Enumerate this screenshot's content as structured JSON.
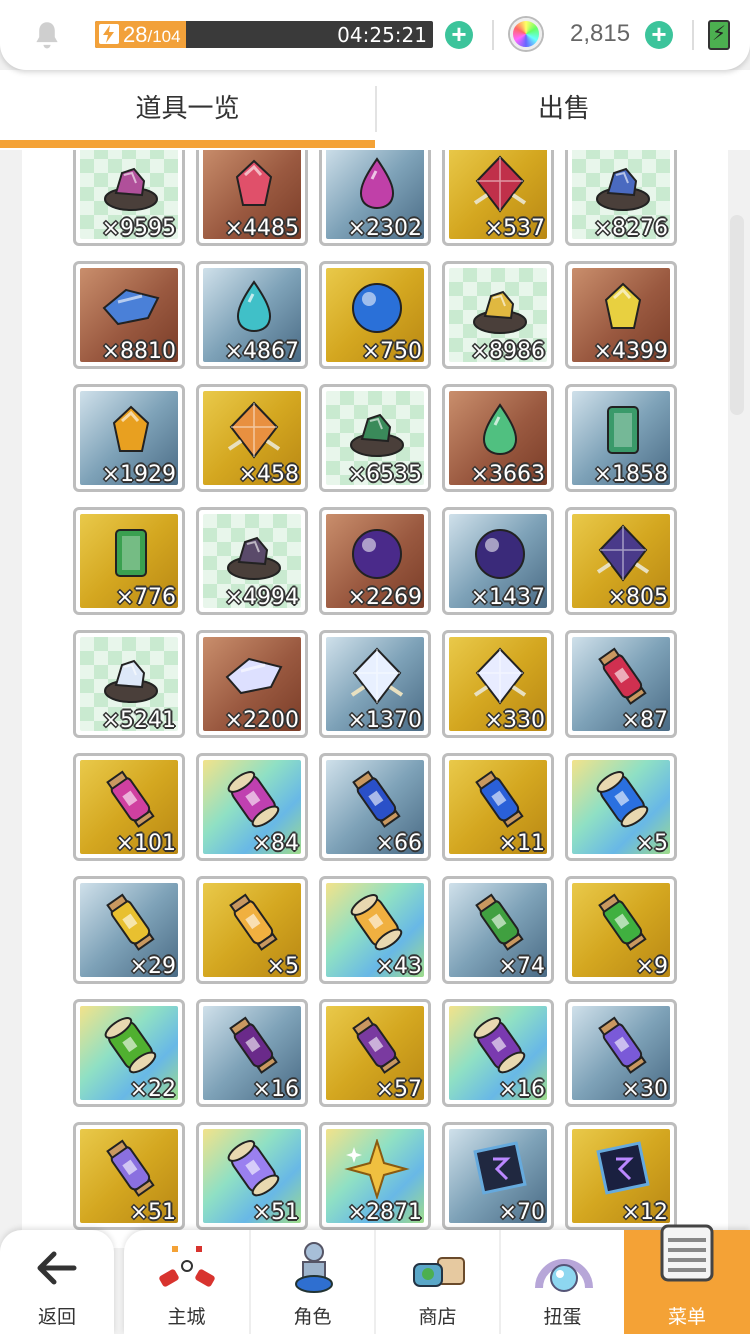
{
  "status": {
    "stamina_current": "28",
    "stamina_max": "/104",
    "stamina_fill": 0.27,
    "timer": "04:25:21",
    "currency": "2,815",
    "battery_symbol": "⚡"
  },
  "tabs": [
    {
      "label": "道具一览",
      "active": true
    },
    {
      "label": "出售",
      "active": false
    }
  ],
  "items": [
    {
      "count": "×9595",
      "bg": "green",
      "shape": "ore",
      "color": "#b0509a"
    },
    {
      "count": "×4485",
      "bg": "brown",
      "shape": "gem",
      "color": "#e0506a"
    },
    {
      "count": "×2302",
      "bg": "blue",
      "shape": "drop",
      "color": "#c040a8"
    },
    {
      "count": "×537",
      "bg": "gold",
      "shape": "crystal",
      "color": "#c0304a"
    },
    {
      "count": "×8276",
      "bg": "green",
      "shape": "ore",
      "color": "#4a6ac0"
    },
    {
      "count": "×8810",
      "bg": "brown",
      "shape": "shard",
      "color": "#4a80d8"
    },
    {
      "count": "×4867",
      "bg": "blue",
      "shape": "drop",
      "color": "#40c0c8"
    },
    {
      "count": "×750",
      "bg": "gold",
      "shape": "orb",
      "color": "#2a70d8"
    },
    {
      "count": "×8986",
      "bg": "green",
      "shape": "ore",
      "color": "#e0b840"
    },
    {
      "count": "×4399",
      "bg": "brown",
      "shape": "gem",
      "color": "#e8d040"
    },
    {
      "count": "×1929",
      "bg": "blue",
      "shape": "gem",
      "color": "#e8a020"
    },
    {
      "count": "×458",
      "bg": "gold",
      "shape": "crystal",
      "color": "#e89040"
    },
    {
      "count": "×6535",
      "bg": "green",
      "shape": "ore",
      "color": "#3a8a5a"
    },
    {
      "count": "×3663",
      "bg": "brown",
      "shape": "drop",
      "color": "#50c080"
    },
    {
      "count": "×1858",
      "bg": "blue",
      "shape": "bar",
      "color": "#3a9a6a"
    },
    {
      "count": "×776",
      "bg": "gold",
      "shape": "bar",
      "color": "#3aa050"
    },
    {
      "count": "×4994",
      "bg": "green",
      "shape": "ore",
      "color": "#5a4a6a"
    },
    {
      "count": "×2269",
      "bg": "brown",
      "shape": "orb",
      "color": "#4a2a8a"
    },
    {
      "count": "×1437",
      "bg": "blue",
      "shape": "orb",
      "color": "#3a2a7a"
    },
    {
      "count": "×805",
      "bg": "gold",
      "shape": "crystal",
      "color": "#4a3a8a"
    },
    {
      "count": "×5241",
      "bg": "green",
      "shape": "ore",
      "color": "#dde8f8"
    },
    {
      "count": "×2200",
      "bg": "brown",
      "shape": "shard",
      "color": "#dde0ff"
    },
    {
      "count": "×1370",
      "bg": "blue",
      "shape": "crystal",
      "color": "#e8f0ff"
    },
    {
      "count": "×330",
      "bg": "gold",
      "shape": "crystal",
      "color": "#e8ecff"
    },
    {
      "count": "×87",
      "bg": "blue",
      "shape": "potion",
      "color": "#d03050"
    },
    {
      "count": "×101",
      "bg": "gold",
      "shape": "potion",
      "color": "#d040a0"
    },
    {
      "count": "×84",
      "bg": "rainbow",
      "shape": "scroll",
      "color": "#c040b0"
    },
    {
      "count": "×66",
      "bg": "blue",
      "shape": "potion",
      "color": "#2a50c8"
    },
    {
      "count": "×11",
      "bg": "gold",
      "shape": "potion",
      "color": "#2a60d8"
    },
    {
      "count": "×5",
      "bg": "rainbow",
      "shape": "scroll",
      "color": "#2a70e0"
    },
    {
      "count": "×29",
      "bg": "blue",
      "shape": "potion",
      "color": "#e8c030"
    },
    {
      "count": "×5",
      "bg": "gold",
      "shape": "potion",
      "color": "#f0b040"
    },
    {
      "count": "×43",
      "bg": "rainbow",
      "shape": "scroll",
      "color": "#f0b040"
    },
    {
      "count": "×74",
      "bg": "blue",
      "shape": "potion",
      "color": "#40a040"
    },
    {
      "count": "×9",
      "bg": "gold",
      "shape": "potion",
      "color": "#40b040"
    },
    {
      "count": "×22",
      "bg": "rainbow",
      "shape": "scroll",
      "color": "#50b030"
    },
    {
      "count": "×16",
      "bg": "blue",
      "shape": "potion",
      "color": "#6a2a8a"
    },
    {
      "count": "×57",
      "bg": "gold",
      "shape": "potion",
      "color": "#7a3aa0"
    },
    {
      "count": "×16",
      "bg": "rainbow",
      "shape": "scroll",
      "color": "#7a3ab0"
    },
    {
      "count": "×30",
      "bg": "blue",
      "shape": "potion",
      "color": "#7a5ad8"
    },
    {
      "count": "×51",
      "bg": "gold",
      "shape": "potion",
      "color": "#8a70e0"
    },
    {
      "count": "×51",
      "bg": "rainbow",
      "shape": "scroll",
      "color": "#9a80f0"
    },
    {
      "count": "×2871",
      "bg": "rainbow",
      "shape": "star",
      "color": "#f0c040"
    },
    {
      "count": "×70",
      "bg": "blue",
      "shape": "rune",
      "color": "#202840"
    },
    {
      "count": "×12",
      "bg": "gold",
      "shape": "rune",
      "color": "#1a2040"
    }
  ],
  "nav": {
    "back_label": "返回",
    "items": [
      {
        "label": "主城",
        "icon": "castle-icon",
        "active": false
      },
      {
        "label": "角色",
        "icon": "character-icon",
        "active": false
      },
      {
        "label": "商店",
        "icon": "shop-icon",
        "active": false
      },
      {
        "label": "扭蛋",
        "icon": "gacha-icon",
        "active": false
      },
      {
        "label": "菜单",
        "icon": "menu-icon",
        "active": true
      }
    ]
  },
  "colors": {
    "accent": "#f4a236",
    "plus": "#3cc49b"
  }
}
